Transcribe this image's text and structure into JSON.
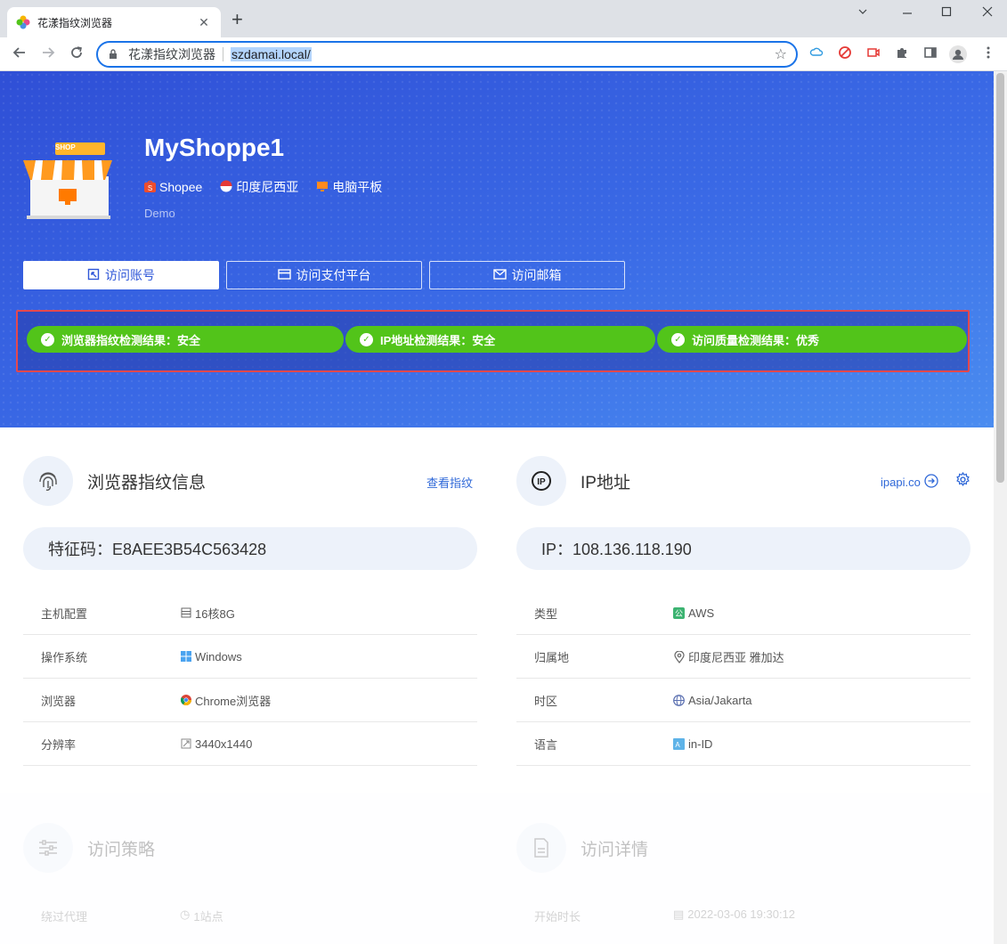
{
  "browser": {
    "tab_title": "花漾指纹浏览器",
    "site_name": "花漾指纹浏览器",
    "url": "szdamai.local/",
    "window_controls": [
      "—",
      "☐",
      "✕"
    ],
    "tab_close": "✕",
    "new_tab": "+"
  },
  "hero": {
    "shop_name": "MyShoppe1",
    "platform": "Shopee",
    "region": "印度尼西亚",
    "device": "电脑平板",
    "tag": "Demo",
    "buttons": {
      "account": "访问账号",
      "payment": "访问支付平台",
      "mail": "访问邮箱"
    },
    "checks": [
      "浏览器指纹检测结果：安全",
      "IP地址检测结果：安全",
      "访问质量检测结果：优秀"
    ],
    "shop_sign": "SHOP"
  },
  "fingerprint": {
    "title": "浏览器指纹信息",
    "link": "查看指纹",
    "code": "特征码：E8AEE3B54C563428",
    "rows": [
      {
        "label": "主机配置",
        "value": "16核8G",
        "icon": "server-icon"
      },
      {
        "label": "操作系统",
        "value": "Windows",
        "icon": "windows-icon"
      },
      {
        "label": "浏览器",
        "value": "Chrome浏览器",
        "icon": "chrome-icon"
      },
      {
        "label": "分辨率",
        "value": "3440x1440",
        "icon": "resolution-icon"
      }
    ]
  },
  "ip": {
    "title": "IP地址",
    "link": "ipapi.co",
    "address": "IP：108.136.118.190",
    "rows": [
      {
        "label": "类型",
        "value": "AWS",
        "icon": "cloud-type-icon"
      },
      {
        "label": "归属地",
        "value": "印度尼西亚 雅加达",
        "icon": "location-icon"
      },
      {
        "label": "时区",
        "value": "Asia/Jakarta",
        "icon": "globe-icon"
      },
      {
        "label": "语言",
        "value": "in-ID",
        "icon": "language-icon"
      }
    ]
  },
  "policy": {
    "title": "访问策略",
    "row_label": "绕过代理",
    "row_value": "1站点"
  },
  "details": {
    "title": "访问详情",
    "row_label": "开始时长",
    "row_value": "2022-03-06 19:30:12"
  },
  "colors": {
    "accent": "#2f57d8",
    "success": "#52c41a",
    "alert_frame": "#e5484d"
  }
}
